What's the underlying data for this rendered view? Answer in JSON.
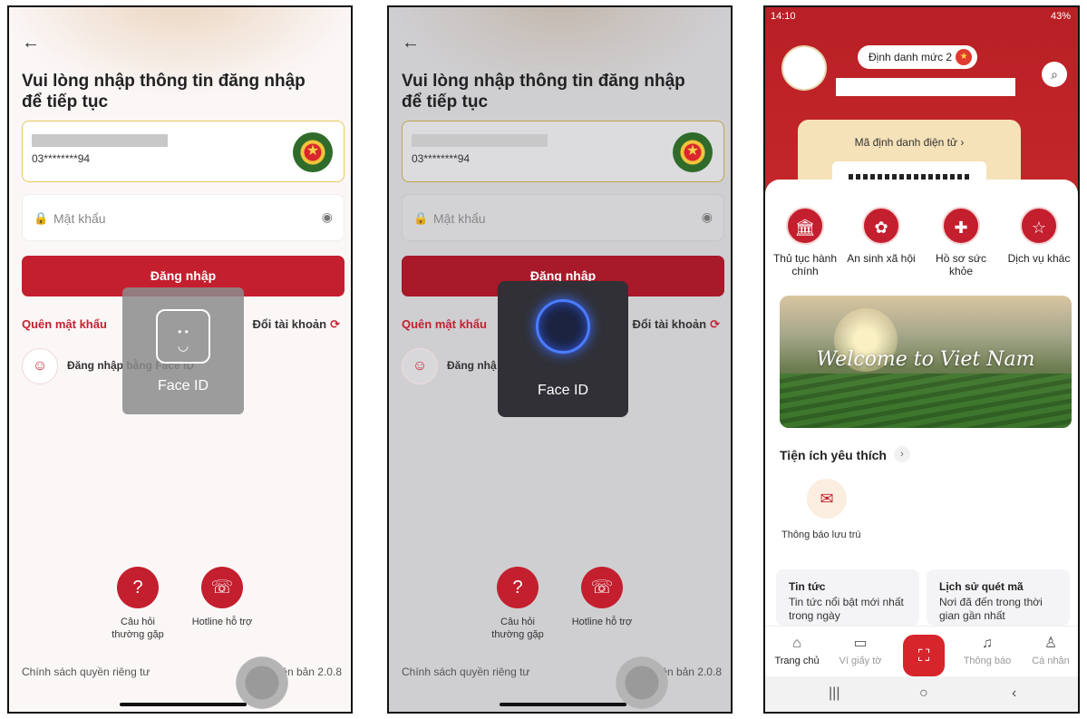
{
  "login": {
    "heading": "Vui lòng nhập thông tin đăng nhập để tiếp tục",
    "account_number": "03********94",
    "password_placeholder": "Mật khẩu",
    "login_button": "Đăng nhập",
    "forgot_password": "Quên mật khẩu",
    "switch_account": "Đổi tài khoản",
    "face_id_login": "Đăng nhập bằng Face ID",
    "face_id_login_short": "Đăng nhậ",
    "faq_label": "Câu hỏi thường gặp",
    "hotline_label": "Hotline hỗ trợ",
    "privacy": "Chính sách quyền riêng tư",
    "version": "Phiên bản 2.0.8",
    "face_id_popup": "Face ID"
  },
  "home": {
    "status_time": "14:10",
    "status_battery": "43%",
    "level_badge": "Định danh mức 2",
    "id_label": "Mã định danh điện tử",
    "services": [
      {
        "label": "Thủ tục hành chính",
        "icon": "building-icon"
      },
      {
        "label": "An sinh xã hội",
        "icon": "flower-icon"
      },
      {
        "label": "Hồ sơ sức khỏe",
        "icon": "health-shield-icon"
      },
      {
        "label": "Dịch vụ khác",
        "icon": "star-icon"
      }
    ],
    "banner_text": "Welcome to Viet Nam",
    "favorites_title": "Tiện ích yêu thích",
    "favorite_item": "Thông báo lưu trú",
    "news": {
      "title": "Tin tức",
      "desc": "Tin tức nổi bật mới nhất trong ngày"
    },
    "history": {
      "title": "Lịch sử quét mã",
      "desc": "Nơi đã đến trong thời gian gần nhất"
    },
    "nav": [
      "Trang chủ",
      "Ví giấy tờ",
      "Thông báo",
      "Cá nhân"
    ]
  },
  "colors": {
    "brand_red": "#c41f2e",
    "gold": "#f6e2b9"
  }
}
